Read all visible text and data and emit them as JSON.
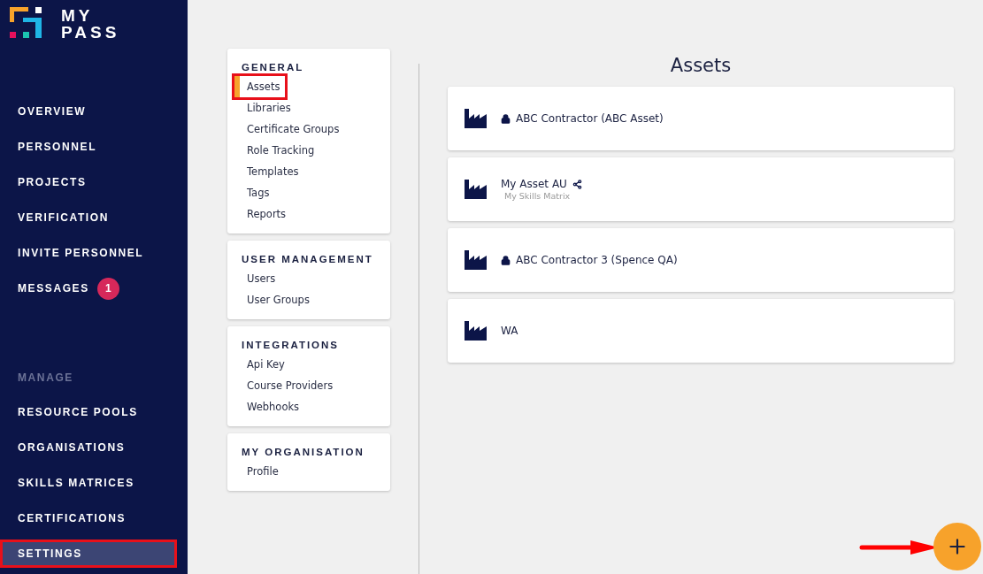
{
  "brand": {
    "line_1": "MY",
    "line_2": "PASS"
  },
  "nav": [
    {
      "label": "OVERVIEW",
      "selected": false,
      "highlighted": false
    },
    {
      "label": "PERSONNEL",
      "selected": false,
      "highlighted": false
    },
    {
      "label": "PROJECTS",
      "selected": false,
      "highlighted": false
    },
    {
      "label": "VERIFICATION",
      "selected": false,
      "highlighted": false
    },
    {
      "label": "INVITE PERSONNEL",
      "selected": false,
      "highlighted": false
    },
    {
      "label": "MESSAGES",
      "selected": false,
      "highlighted": false,
      "badge": "1"
    }
  ],
  "manage": {
    "heading": "MANAGE",
    "items": [
      {
        "label": "RESOURCE POOLS",
        "selected": false,
        "highlighted": false
      },
      {
        "label": "ORGANISATIONS",
        "selected": false,
        "highlighted": false
      },
      {
        "label": "SKILLS MATRICES",
        "selected": false,
        "highlighted": false
      },
      {
        "label": "CERTIFICATIONS",
        "selected": false,
        "highlighted": false
      },
      {
        "label": "SETTINGS",
        "selected": true,
        "highlighted": true
      }
    ]
  },
  "settings_menu": [
    {
      "heading": "GENERAL",
      "items": [
        {
          "label": "Assets",
          "selected": true,
          "highlighted": true
        },
        {
          "label": "Libraries",
          "selected": false,
          "highlighted": false
        },
        {
          "label": "Certificate Groups",
          "selected": false,
          "highlighted": false
        },
        {
          "label": "Role Tracking",
          "selected": false,
          "highlighted": false
        },
        {
          "label": "Templates",
          "selected": false,
          "highlighted": false
        },
        {
          "label": "Tags",
          "selected": false,
          "highlighted": false
        },
        {
          "label": "Reports",
          "selected": false,
          "highlighted": false
        }
      ]
    },
    {
      "heading": "USER MANAGEMENT",
      "items": [
        {
          "label": "Users",
          "selected": false,
          "highlighted": false
        },
        {
          "label": "User Groups",
          "selected": false,
          "highlighted": false
        }
      ]
    },
    {
      "heading": "INTEGRATIONS",
      "items": [
        {
          "label": "Api Key",
          "selected": false,
          "highlighted": false
        },
        {
          "label": "Course Providers",
          "selected": false,
          "highlighted": false
        },
        {
          "label": "Webhooks",
          "selected": false,
          "highlighted": false
        }
      ]
    },
    {
      "heading": "MY ORGANISATION",
      "items": [
        {
          "label": "Profile",
          "selected": false,
          "highlighted": false
        }
      ]
    }
  ],
  "assets": {
    "title": "Assets",
    "rows": [
      {
        "kind": "locked",
        "name": "ABC Contractor (ABC Asset)"
      },
      {
        "kind": "shared",
        "name": "My Asset AU",
        "subtitle": "My Skills Matrix"
      },
      {
        "kind": "locked",
        "name": "ABC Contractor 3 (Spence QA)"
      },
      {
        "kind": "plain",
        "name": "WA"
      }
    ]
  },
  "add_button": {
    "pointer_arrow": true
  }
}
